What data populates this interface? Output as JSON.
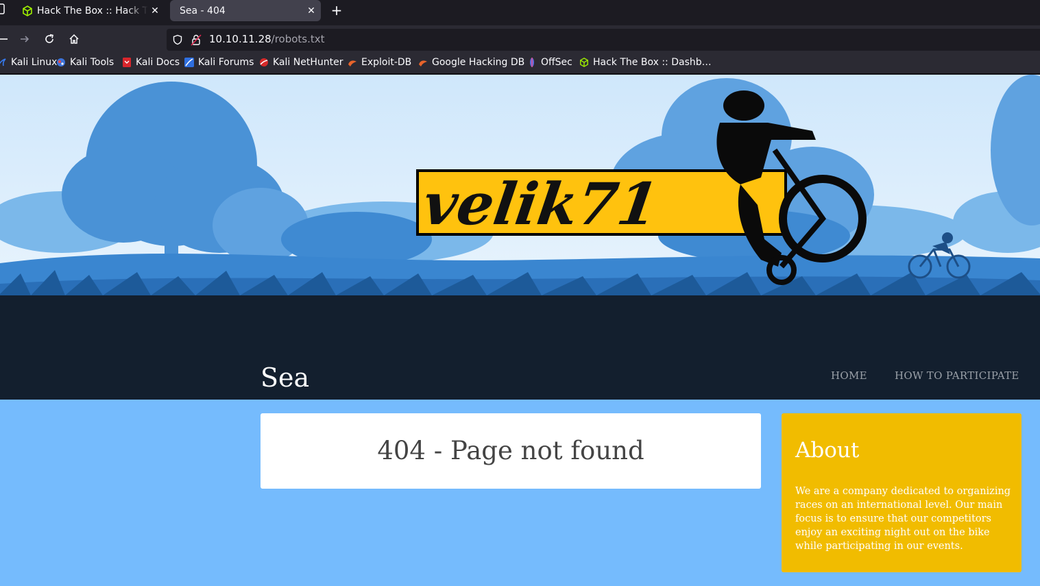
{
  "browser": {
    "tabs": [
      {
        "title": "Hack The Box :: Hack The Box",
        "icon": "htb-cube-icon",
        "active": false
      },
      {
        "title": "Sea - 404",
        "icon": "",
        "active": true
      }
    ],
    "url_host": "10.10.11.28",
    "url_path": "/robots.txt",
    "bookmarks": [
      {
        "label": "Kali Linux",
        "icon": "kali-dragon-icon"
      },
      {
        "label": "Kali Tools",
        "icon": "kali-tools-icon"
      },
      {
        "label": "Kali Docs",
        "icon": "kali-docs-icon"
      },
      {
        "label": "Kali Forums",
        "icon": "kali-forums-icon"
      },
      {
        "label": "Kali NetHunter",
        "icon": "kali-nethunter-icon"
      },
      {
        "label": "Exploit-DB",
        "icon": "exploit-db-icon"
      },
      {
        "label": "Google Hacking DB",
        "icon": "ghdb-icon"
      },
      {
        "label": "OffSec",
        "icon": "offsec-icon"
      },
      {
        "label": "Hack The Box :: Dashb…",
        "icon": "htb-cube-icon"
      }
    ]
  },
  "site": {
    "logo_text": "velik71",
    "title": "Sea",
    "nav": [
      "HOME",
      "HOW TO PARTICIPATE"
    ],
    "main_heading": "404 - Page not found",
    "sidebar": {
      "heading": "About",
      "text": "We are a company dedicated to organizing races on an international level. Our main focus is to ensure that our competitors enjoy an exciting night out on the bike while participating in our events."
    }
  },
  "colors": {
    "page_bg": "#75bbfd",
    "header_dark": "#131f2e",
    "about_bg": "#f1bc00",
    "logo_yellow": "#ffc20e"
  }
}
